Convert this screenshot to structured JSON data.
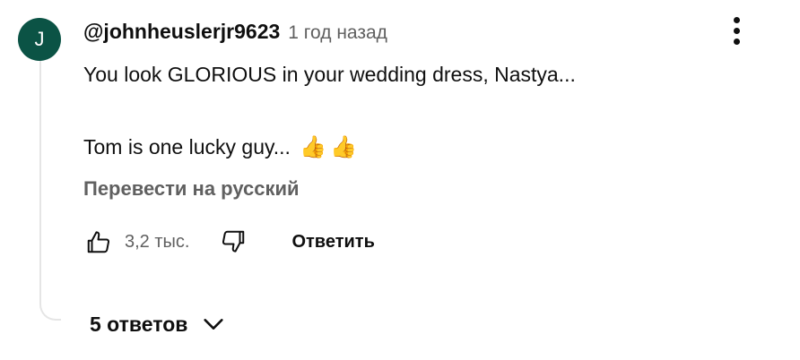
{
  "comment": {
    "avatar_letter": "J",
    "avatar_color": "#0b5345",
    "author": "@johnheuslerjr9623",
    "time": "1 год назад",
    "text_line1": "You look GLORIOUS in your wedding dress, Nastya...",
    "text_line2": "Tom is one lucky guy...",
    "emoji": [
      "👍",
      "👍"
    ],
    "translate_label": "Перевести на русский",
    "likes": "3,2 тыс.",
    "reply_label": "Ответить",
    "replies_label": "5 ответов"
  },
  "icons": {
    "menu": "more-vert-icon",
    "like": "thumb-up-icon",
    "dislike": "thumb-down-icon",
    "expand": "chevron-down-icon"
  }
}
